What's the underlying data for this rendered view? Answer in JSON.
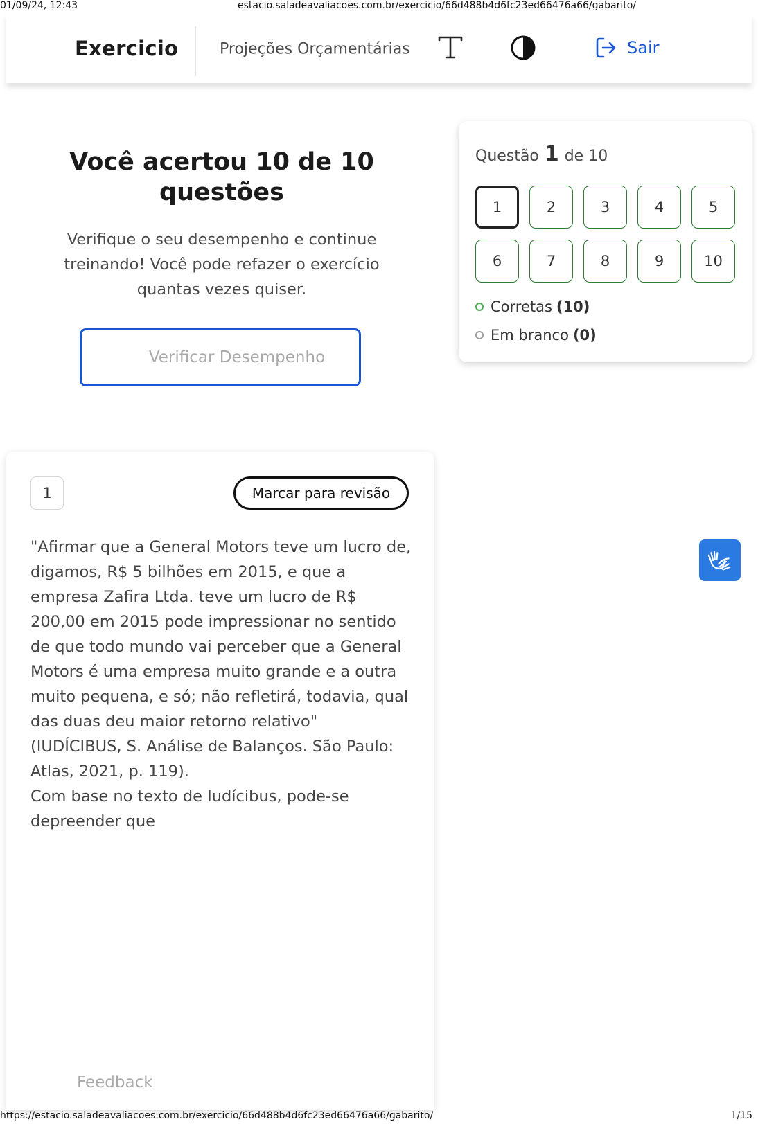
{
  "print_header": {
    "datetime": "01/09/24, 12:43",
    "title": "estacio.saladeavaliacoes.com.br/exercicio/66d488b4d6fc23ed66476a66/gabarito/"
  },
  "print_footer": {
    "url": "https://estacio.saladeavaliacoes.com.br/exercicio/66d488b4d6fc23ed66476a66/gabarito/",
    "page": "1/15"
  },
  "nav": {
    "brand": "Exercicio",
    "subject": "Projeções Orçamentárias",
    "font_icon": "font-size-icon",
    "contrast_icon": "contrast-icon",
    "logout_icon": "logout-icon",
    "logout_label": "Sair"
  },
  "result": {
    "title": "Você acertou 10 de 10 questões",
    "text": "Verifique o seu desempenho e continue treinando! Você pode refazer o exercício quantas vezes quiser.",
    "verify_button": "Verificar Desempenho"
  },
  "question_nav": {
    "prefix": "Questão",
    "current": "1",
    "suffix": "de 10",
    "buttons": [
      "1",
      "2",
      "3",
      "4",
      "5",
      "6",
      "7",
      "8",
      "9",
      "10"
    ],
    "legend_correct_label": "Corretas",
    "legend_correct_count": "(10)",
    "legend_blank_label": "Em branco",
    "legend_blank_count": "(0)"
  },
  "question": {
    "number": "1",
    "review_button": "Marcar para revisão",
    "paragraph1": "\"Afirmar que a General Motors teve um lucro de, digamos, R$ 5 bilhões em 2015, e que a empresa Zafira Ltda. teve um lucro de R$ 200,00 em 2015 pode impressionar no sentido de que todo mundo vai perceber que a General Motors é uma empresa muito grande e a outra muito pequena, e só; não refletirá, todavia, qual das duas deu maior retorno relativo\" (IUDÍCIBUS, S. Análise de Balanços. São Paulo: Atlas, 2021, p. 119).",
    "paragraph2": "Com base no texto de Iudícibus, pode-se depreender que",
    "feedback": "Feedback"
  },
  "libras_icon": "sign-language-icon",
  "colors": {
    "accent": "#1a55d4",
    "correct_border": "#2e7d32",
    "libras_bg": "#2a7ae2"
  }
}
